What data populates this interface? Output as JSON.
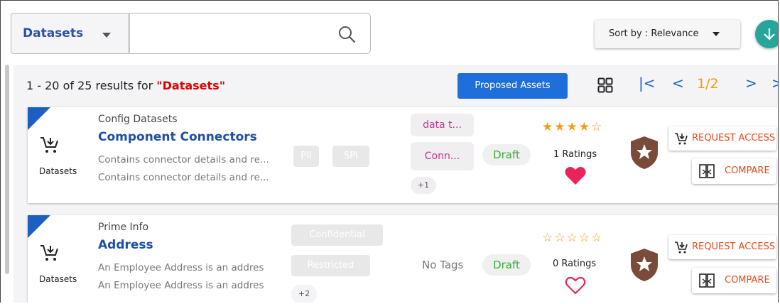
{
  "search": {
    "type_label": "Datasets",
    "value": "",
    "placeholder": ""
  },
  "sort": {
    "label": "Sort by : Relevance"
  },
  "summary": {
    "prefix": "1 - 20 of 25 results for ",
    "query": "\"Datasets\""
  },
  "proposed_assets_label": "Proposed Assets",
  "pager": {
    "first": "|<",
    "prev": "<",
    "page": "1/2",
    "next": ">",
    "last": ">"
  },
  "cards": [
    {
      "type_label": "Datasets",
      "category": "Config Datasets",
      "title": "Component Connectors",
      "desc1": "Contains connector details and re...",
      "desc2": "Contains connector details and re...",
      "classifications": [
        "PII",
        "SPI"
      ],
      "tags": [
        "data t...",
        "Conn..."
      ],
      "more_tags": "+1",
      "status": "Draft",
      "stars_text": "★★★★☆",
      "ratings": "1 Ratings",
      "favorited": true,
      "request_access": "REQUEST ACCESS",
      "compare": "COMPARE"
    },
    {
      "type_label": "Datasets",
      "category": "Prime Info",
      "title": "Address",
      "desc1": "An Employee Address is an addres",
      "desc2": "An Employee Address is an addres",
      "classifications": [
        "Confidential",
        "Restricted"
      ],
      "more_classifications": "+2",
      "no_tags": "No Tags",
      "status": "Draft",
      "stars_text": "☆☆☆☆☆",
      "ratings": "0 Ratings",
      "favorited": false,
      "request_access": "REQUEST ACCESS",
      "compare": "COMPARE"
    }
  ],
  "colors": {
    "accent": "#1e6fd9",
    "title": "#1d4fa8",
    "query": "#e10000",
    "star": "#f39c12",
    "heart": "#e8245a",
    "badge": "#7a4a3a",
    "fab": "#26a69a",
    "status": "#3aaa3a"
  }
}
